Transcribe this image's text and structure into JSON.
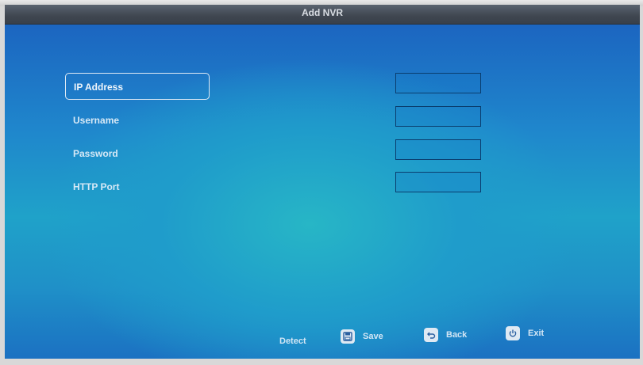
{
  "window": {
    "title": "Add NVR"
  },
  "form": {
    "rows": [
      {
        "label": "IP Address",
        "value": ""
      },
      {
        "label": "Username",
        "value": ""
      },
      {
        "label": "Password",
        "value": ""
      },
      {
        "label": "HTTP Port",
        "value": ""
      }
    ]
  },
  "footer": {
    "detect_label": "Detect",
    "save_label": "Save",
    "back_label": "Back",
    "exit_label": "Exit"
  },
  "icons": {
    "save": "save-icon",
    "back": "back-arrow-icon",
    "exit": "power-icon"
  }
}
